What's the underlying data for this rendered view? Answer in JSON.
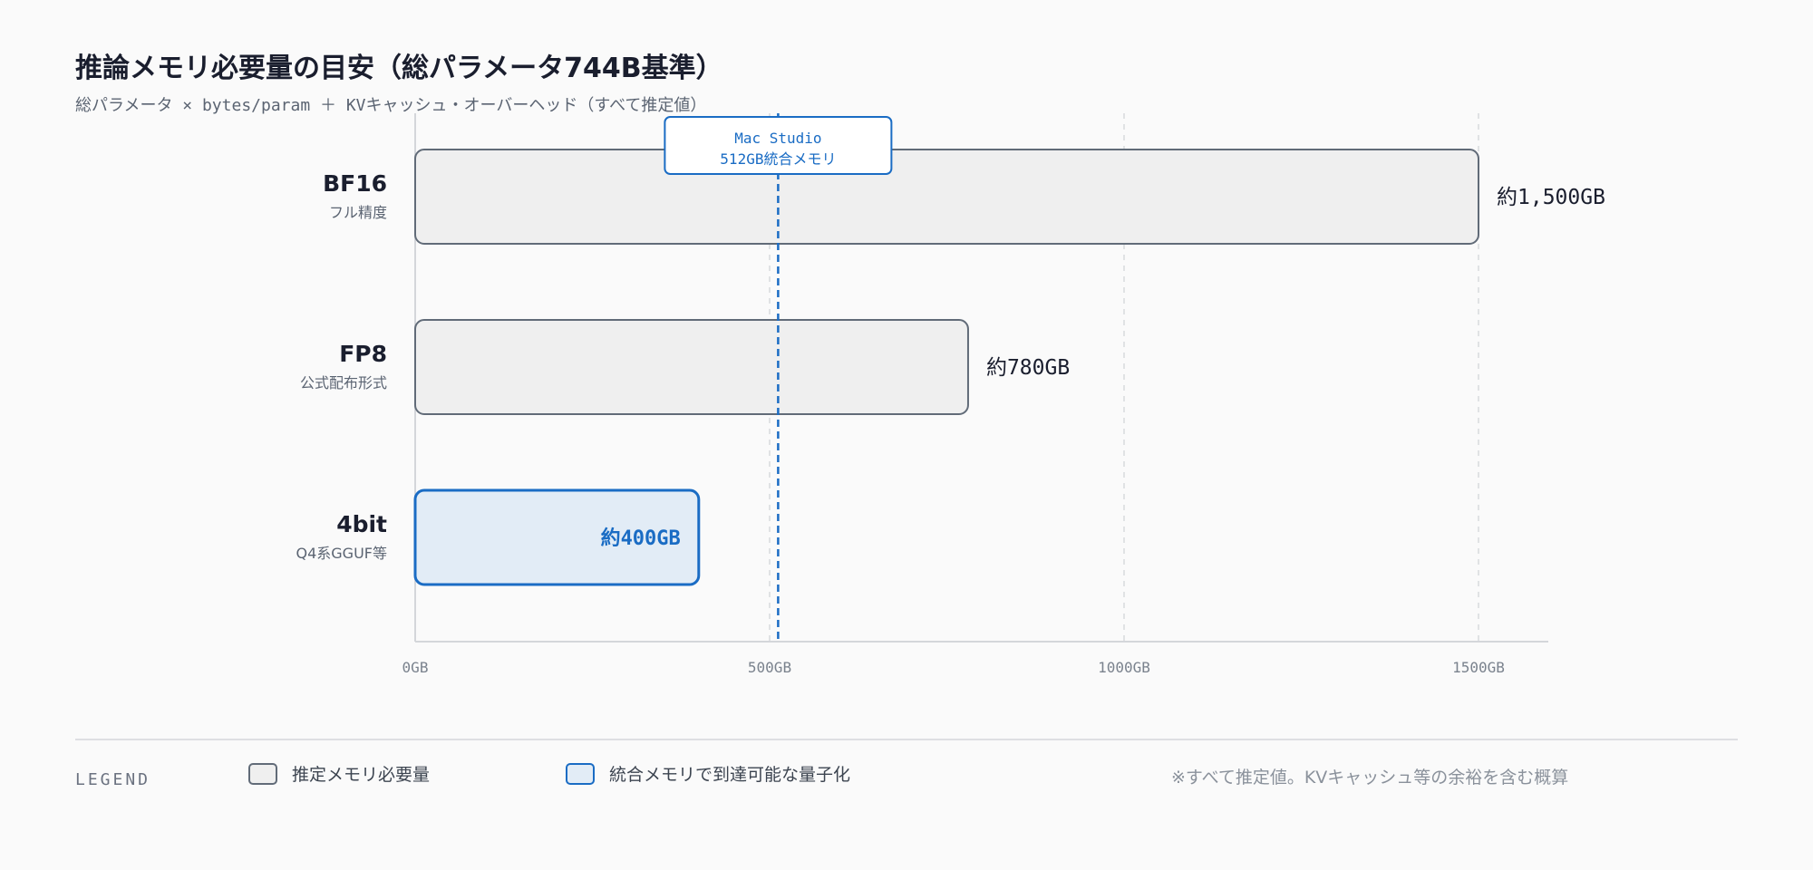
{
  "header": {
    "title": "推論メモリ必要量の目安（総パラメータ744B基準）",
    "subtitle": "総パラメータ × bytes/param ＋ KVキャッシュ・オーバーヘッド（すべて推定値）"
  },
  "chart_data": {
    "type": "bar",
    "orientation": "horizontal",
    "categories": [
      "BF16",
      "FP8",
      "4bit"
    ],
    "category_sublabels": [
      "フル精度",
      "公式配布形式",
      "Q4系GGUF等"
    ],
    "values": [
      1500,
      780,
      400
    ],
    "value_labels": [
      "約1,500GB",
      "約780GB",
      "約400GB"
    ],
    "highlighted": [
      false,
      false,
      true
    ],
    "xlim": [
      0,
      1600
    ],
    "x_ticks": [
      0,
      500,
      1000,
      1500
    ],
    "x_tick_labels": [
      "0GB",
      "500GB",
      "1000GB",
      "1500GB"
    ],
    "grid": true,
    "reference_line": {
      "value": 512,
      "label_lines": [
        "Mac Studio",
        "512GB統合メモリ"
      ]
    }
  },
  "legend": {
    "heading": "LEGEND",
    "items": [
      {
        "label": "推定メモリ必要量"
      },
      {
        "label": "統合メモリで到達可能な量子化"
      }
    ]
  },
  "footnote": "※すべて推定値。KVキャッシュ等の余裕を含む概算",
  "colors": {
    "bar_fill": "#efefef",
    "bar_stroke": "#616b78",
    "highlight_fill": "#e2ecf6",
    "highlight_stroke": "#1a6cc4",
    "reference_line": "#1a6cc4",
    "grid": "#d8d9dc",
    "axis": "#d4d6da",
    "tick_text": "#7a828d",
    "value_text": "#1a1e2e"
  }
}
